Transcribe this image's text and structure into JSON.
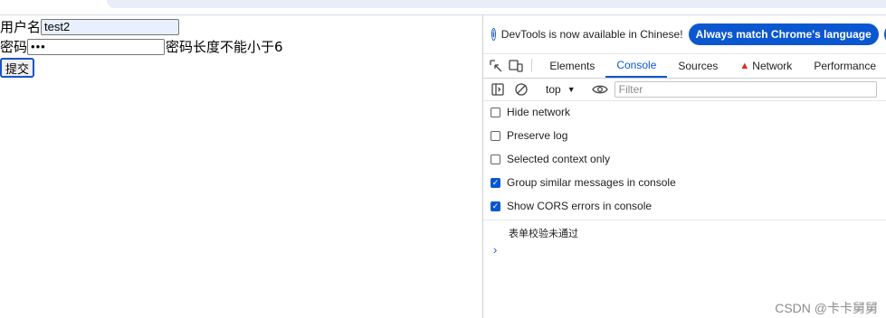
{
  "form": {
    "username_label": "用户名",
    "username_value": "test2",
    "password_label": "密码",
    "password_value": "•••",
    "password_error": "密码长度不能小于6",
    "submit_label": "提交"
  },
  "devtools": {
    "info_text": "DevTools is now available in Chinese!",
    "match_language_label": "Always match Chrome's language",
    "switch_label": "S",
    "tabs": [
      "Elements",
      "Console",
      "Sources",
      "Network",
      "Performance"
    ],
    "active_tab": "Console",
    "context": "top",
    "filter_placeholder": "Filter",
    "settings": [
      {
        "label": "Hide network",
        "checked": false
      },
      {
        "label": "Preserve log",
        "checked": false
      },
      {
        "label": "Selected context only",
        "checked": false
      },
      {
        "label": "Group similar messages in console",
        "checked": true
      },
      {
        "label": "Show CORS errors in console",
        "checked": true
      }
    ],
    "console_message": "表单校验未通过",
    "prompt_symbol": "›"
  },
  "watermark": "CSDN @卡卡舅舅",
  "colors": {
    "accent": "#0b57d0",
    "autofill": "#e8f0fe",
    "warning": "#e3281d"
  }
}
